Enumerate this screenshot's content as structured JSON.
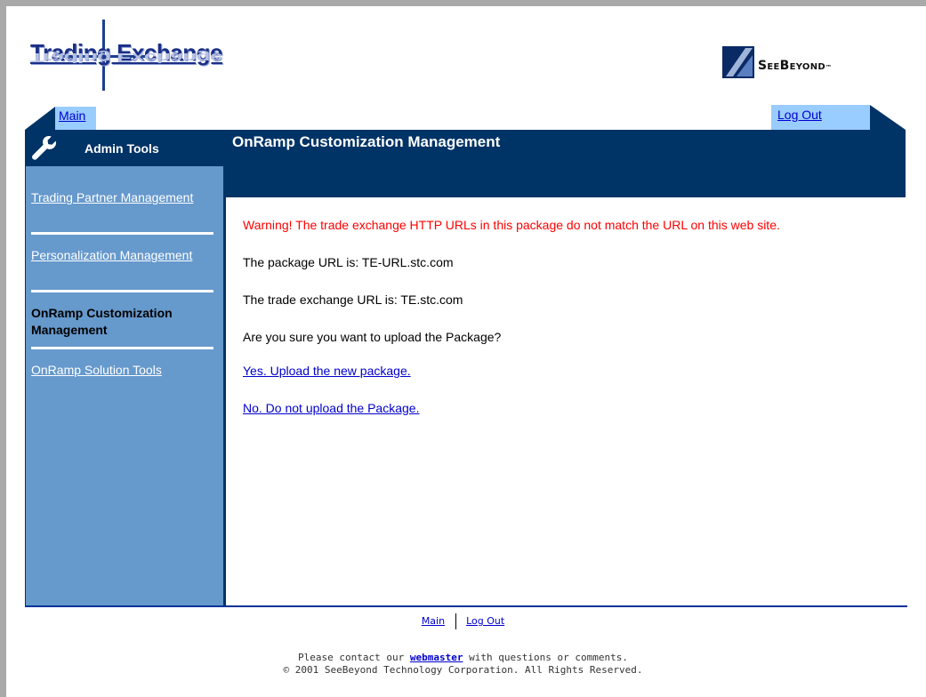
{
  "header": {
    "logo_text": "Trading Exchange",
    "brand_text": "SeeBeyond",
    "brand_tm": "™"
  },
  "tabs": {
    "main_label": "Main",
    "logout_label": "Log Out"
  },
  "sidebar": {
    "title": "Admin Tools",
    "items": [
      {
        "label": "Trading Partner Management",
        "active": false
      },
      {
        "label": "Personalization Management",
        "active": false
      },
      {
        "label": "OnRamp Customization Management",
        "active": true
      },
      {
        "label": "OnRamp Solution Tools",
        "active": false
      }
    ]
  },
  "main": {
    "title": "OnRamp Customization Management",
    "warning": "Warning! The trade exchange HTTP URLs in this package do not match the URL on this web site.",
    "package_url_text": "The package URL is: TE-URL.stc.com",
    "exchange_url_text": "The trade exchange URL is: TE.stc.com",
    "question": "Are you sure you want to upload the Package?",
    "yes_link": "Yes. Upload the new package.",
    "no_link": "No. Do not upload the Package."
  },
  "footer": {
    "main_link": "Main",
    "logout_link": "Log Out",
    "contact_prefix": "Please contact our",
    "webmaster_link": "webmaster",
    "contact_suffix": "with questions or comments.",
    "copyright": "© 2001 SeeBeyond Technology Corporation. All Rights Reserved."
  },
  "colors": {
    "navy": "#003366",
    "sidebar_blue": "#6699cc",
    "tab_blue": "#99ccff",
    "warning_red": "#ff0000",
    "link_blue": "#0000cc"
  },
  "icons": [
    "wrench-icon",
    "seebeyond-logo-icon"
  ]
}
